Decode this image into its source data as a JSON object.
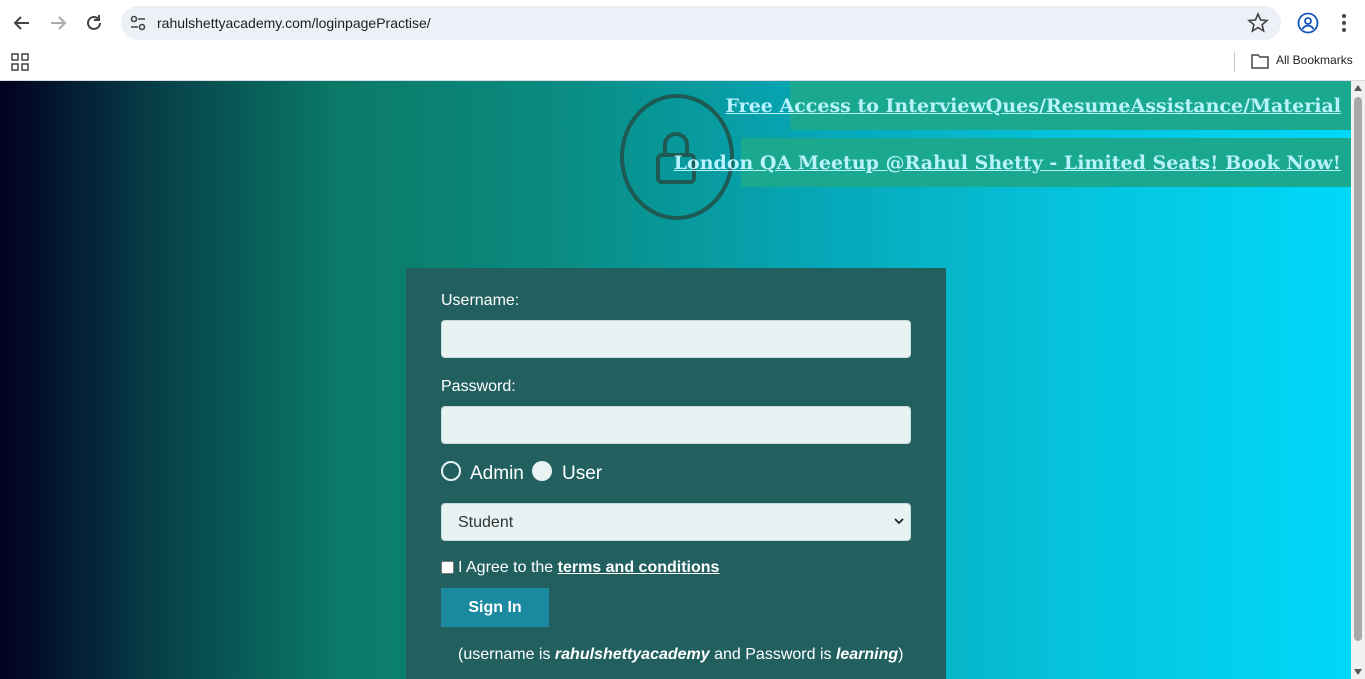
{
  "browser": {
    "url": "rahulshettyacademy.com/loginpagePractise/",
    "bookmarks_label": "All Bookmarks"
  },
  "banners": {
    "interview": "Free Access to InterviewQues/ResumeAssistance/Material",
    "meetup": "London QA Meetup @Rahul Shetty - Limited Seats! Book Now!"
  },
  "form": {
    "username_label": "Username:",
    "username_value": "",
    "password_label": "Password:",
    "password_value": "",
    "radio_admin": "Admin",
    "radio_user": "User",
    "role_selected": "Student",
    "terms_prefix": "I Agree to the ",
    "terms_link": "terms and conditions",
    "signin_label": "Sign In",
    "hint_open": "(username is ",
    "hint_user": "rahulshettyacademy",
    "hint_mid": " and Password is ",
    "hint_pass": "learning",
    "hint_close": ")"
  },
  "colors": {
    "form_bg": "#226060",
    "banner_bg": "#1aa98e",
    "button_bg": "#1b8aa1"
  }
}
